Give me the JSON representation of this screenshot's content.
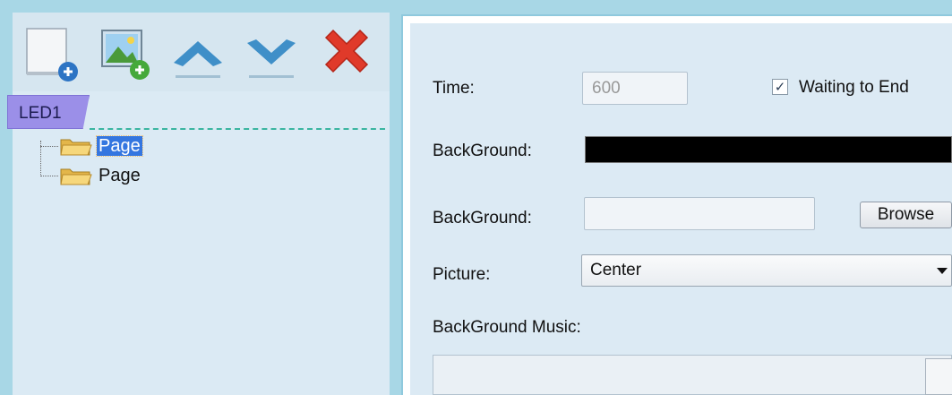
{
  "toolbar": {
    "buttons": [
      {
        "name": "add-page-button",
        "icon": "blank-page-plus-icon"
      },
      {
        "name": "add-picture-button",
        "icon": "picture-plus-icon"
      },
      {
        "name": "move-up-button",
        "icon": "chevron-up-icon"
      },
      {
        "name": "move-down-button",
        "icon": "chevron-down-icon"
      },
      {
        "name": "delete-button",
        "icon": "red-x-icon"
      }
    ]
  },
  "tree": {
    "root_tab": "LED1",
    "items": [
      {
        "label": "Page",
        "selected": true
      },
      {
        "label": "Page",
        "selected": false
      }
    ]
  },
  "properties": {
    "time_label": "Time:",
    "time_value": "600",
    "waiting_label": "Waiting to End",
    "waiting_checked": "✓",
    "background_color_label": "BackGround:",
    "background_color": "#000000",
    "background_image_label": "BackGround:",
    "background_image_value": "",
    "browse_label": "Browse",
    "picture_label": "Picture:",
    "picture_value": "Center",
    "music_label": "BackGround Music:",
    "music_value": ""
  },
  "colors": {
    "frame": "#a8d7e6",
    "panel": "#dbeaf4",
    "selection": "#3476e0",
    "tab": "#9b8fe8",
    "dash": "#3ab5a0"
  }
}
